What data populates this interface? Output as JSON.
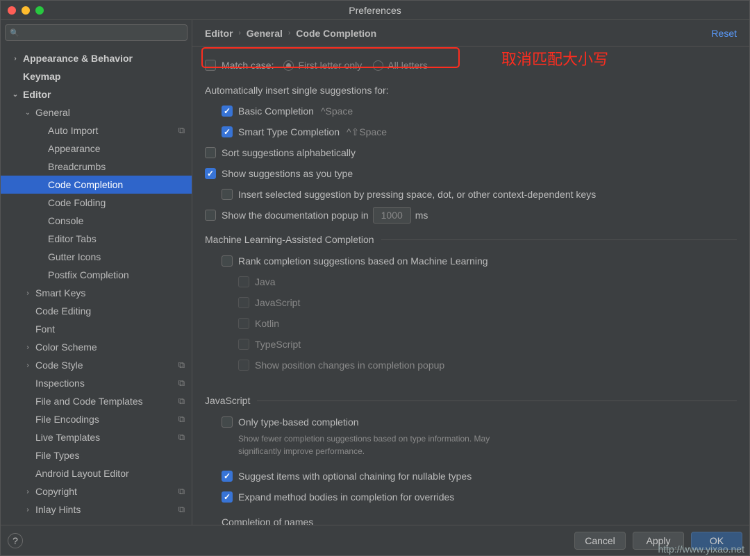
{
  "window": {
    "title": "Preferences"
  },
  "search": {
    "placeholder": "",
    "icon": "🔍"
  },
  "sidebar": {
    "items": [
      {
        "label": "Appearance & Behavior",
        "indent": 0,
        "chev": "›",
        "bold": true
      },
      {
        "label": "Keymap",
        "indent": 0,
        "bold": true
      },
      {
        "label": "Editor",
        "indent": 0,
        "chev": "⌄",
        "bold": true
      },
      {
        "label": "General",
        "indent": 1,
        "chev": "⌄"
      },
      {
        "label": "Auto Import",
        "indent": 2,
        "copy": true
      },
      {
        "label": "Appearance",
        "indent": 2
      },
      {
        "label": "Breadcrumbs",
        "indent": 2
      },
      {
        "label": "Code Completion",
        "indent": 2,
        "selected": true
      },
      {
        "label": "Code Folding",
        "indent": 2
      },
      {
        "label": "Console",
        "indent": 2
      },
      {
        "label": "Editor Tabs",
        "indent": 2
      },
      {
        "label": "Gutter Icons",
        "indent": 2
      },
      {
        "label": "Postfix Completion",
        "indent": 2
      },
      {
        "label": "Smart Keys",
        "indent": 1,
        "chev": "›"
      },
      {
        "label": "Code Editing",
        "indent": 1
      },
      {
        "label": "Font",
        "indent": 1
      },
      {
        "label": "Color Scheme",
        "indent": 1,
        "chev": "›"
      },
      {
        "label": "Code Style",
        "indent": 1,
        "chev": "›",
        "copy": true
      },
      {
        "label": "Inspections",
        "indent": 1,
        "copy": true
      },
      {
        "label": "File and Code Templates",
        "indent": 1,
        "copy": true
      },
      {
        "label": "File Encodings",
        "indent": 1,
        "copy": true
      },
      {
        "label": "Live Templates",
        "indent": 1,
        "copy": true
      },
      {
        "label": "File Types",
        "indent": 1
      },
      {
        "label": "Android Layout Editor",
        "indent": 1
      },
      {
        "label": "Copyright",
        "indent": 1,
        "chev": "›",
        "copy": true
      },
      {
        "label": "Inlay Hints",
        "indent": 1,
        "chev": "›",
        "copy": true
      }
    ]
  },
  "breadcrumbs": {
    "a": "Editor",
    "b": "General",
    "c": "Code Completion",
    "reset": "Reset"
  },
  "form": {
    "matchCase": {
      "label": "Match case:",
      "opt1": "First letter only",
      "opt2": "All letters"
    },
    "autoInsert": "Automatically insert single suggestions for:",
    "basic": {
      "label": "Basic Completion",
      "shortcut": "^Space"
    },
    "smart": {
      "label": "Smart Type Completion",
      "shortcut": "^⇧Space"
    },
    "sort": "Sort suggestions alphabetically",
    "asType": "Show suggestions as you type",
    "insertSel": "Insert selected suggestion by pressing space, dot, or other context-dependent keys",
    "doc": {
      "before": "Show the documentation popup in",
      "value": "1000",
      "after": "ms"
    },
    "mlFieldset": "Machine Learning-Assisted Completion",
    "rank": "Rank completion suggestions based on Machine Learning",
    "langs": [
      "Java",
      "JavaScript",
      "Kotlin",
      "TypeScript"
    ],
    "showPos": "Show position changes in completion popup",
    "jsFieldset": "JavaScript",
    "only": {
      "label": "Only type-based completion",
      "hint": "Show fewer completion suggestions based on type information. May significantly improve performance."
    },
    "optChain": "Suggest items with optional chaining for nullable types",
    "expand": "Expand method bodies in completion for overrides",
    "compNames": "Completion of names"
  },
  "annotation": "取消匹配大小写",
  "footer": {
    "cancel": "Cancel",
    "apply": "Apply",
    "ok": "OK"
  },
  "watermark": "http://www.yixao.net"
}
